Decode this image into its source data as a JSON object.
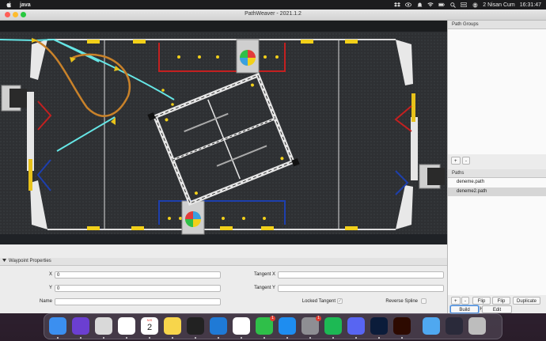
{
  "menubar": {
    "app_name": "java",
    "date": "2 Nisan Cum",
    "time": "16:31:47",
    "icons": [
      "apple-icon",
      "dropbox-icon",
      "eye-icon",
      "bell-icon",
      "wifi-icon",
      "battery-icon",
      "search-icon",
      "control-center-icon",
      "user-icon"
    ]
  },
  "window": {
    "title": "PathWeaver - 2021.1.2"
  },
  "right_panel": {
    "path_groups_header": "Path Groups",
    "paths_header": "Paths",
    "add_label": "+",
    "remove_label": "-",
    "paths": [
      {
        "name": "deneme.path",
        "selected": false
      },
      {
        "name": "deneme2.path",
        "selected": true
      }
    ],
    "flip_h_label": "Flip H",
    "flip_v_label": "Flip V",
    "duplicate_label": "Duplicate",
    "build_paths_label": "Build Paths",
    "edit_project_label": "Edit Project"
  },
  "waypoint_properties": {
    "header": "Waypoint Properties",
    "x_label": "X",
    "x_value": "0",
    "y_label": "Y",
    "y_value": "0",
    "name_label": "Name",
    "name_value": "",
    "tangent_x_label": "Tangent X",
    "tangent_x_value": "",
    "tangent_y_label": "Tangent Y",
    "tangent_y_value": "",
    "locked_tangent_label": "Locked Tangent",
    "locked_tangent_checked": true,
    "reverse_spline_label": "Reverse Spline",
    "reverse_spline_checked": false
  },
  "dock": {
    "calendar_month": "NIS",
    "calendar_day": "2",
    "apps": [
      {
        "name": "finder-icon",
        "color": "#3b8ff0"
      },
      {
        "name": "siri-icon",
        "color": "#6b3fd1"
      },
      {
        "name": "launchpad-icon",
        "color": "#d9d9d9"
      },
      {
        "name": "chrome-icon",
        "color": "#ffffff"
      },
      {
        "name": "calendar-icon",
        "color": "#ffffff"
      },
      {
        "name": "notes-icon",
        "color": "#f7d54b"
      },
      {
        "name": "terminal-icon",
        "color": "#222222"
      },
      {
        "name": "vscode-icon",
        "color": "#1f7ad6"
      },
      {
        "name": "photos-icon",
        "color": "#ffffff"
      },
      {
        "name": "facetime-icon",
        "color": "#2fbf49",
        "badge": "1"
      },
      {
        "name": "app-store-icon",
        "color": "#1e8df0"
      },
      {
        "name": "system-preferences-icon",
        "color": "#8e8e93",
        "badge": "1"
      },
      {
        "name": "spotify-icon",
        "color": "#1db954"
      },
      {
        "name": "discord-icon",
        "color": "#5865f2"
      },
      {
        "name": "photoshop-icon",
        "color": "#0b1c3a"
      },
      {
        "name": "illustrator-icon",
        "color": "#2d0a00"
      },
      {
        "name": "downloads-folder-icon",
        "color": "#4fa8f0"
      },
      {
        "name": "window-preview-icon",
        "color": "#2a2a3a"
      },
      {
        "name": "trash-icon",
        "color": "#bdbdbd"
      }
    ]
  },
  "colors": {
    "path_spline": "#c9822a",
    "path_cyan": "#66e6e6",
    "alliance_red": "#c42020",
    "alliance_blue": "#1d3fae",
    "power_cell": "#f2d01a"
  }
}
